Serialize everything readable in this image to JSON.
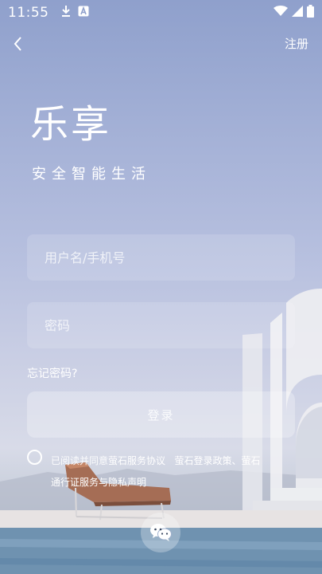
{
  "status_bar": {
    "time": "11:55",
    "left_icons": [
      "download-icon",
      "a-notification-icon"
    ],
    "right_icons": [
      "wifi-icon",
      "signal-icon",
      "battery-icon"
    ]
  },
  "nav": {
    "back_icon": "chevron-left-icon",
    "register_label": "注册"
  },
  "brand": {
    "title": "乐享",
    "slogan": "安全智能生活"
  },
  "form": {
    "username_placeholder": "用户名/手机号",
    "password_placeholder": "密码",
    "forgot_label": "忘记密码?",
    "login_label": "登录"
  },
  "agreement": {
    "prefix": "已阅读并同意",
    "link1": "萤石服务协议",
    "link2": "萤石登录政策、萤石",
    "link3": "通行证服务与隐私声明"
  },
  "social": {
    "wechat_icon": "wechat-icon"
  },
  "colors": {
    "background_top": "#8fa0cc",
    "background_bottom": "#8fa6bd",
    "text": "#ffffff"
  }
}
